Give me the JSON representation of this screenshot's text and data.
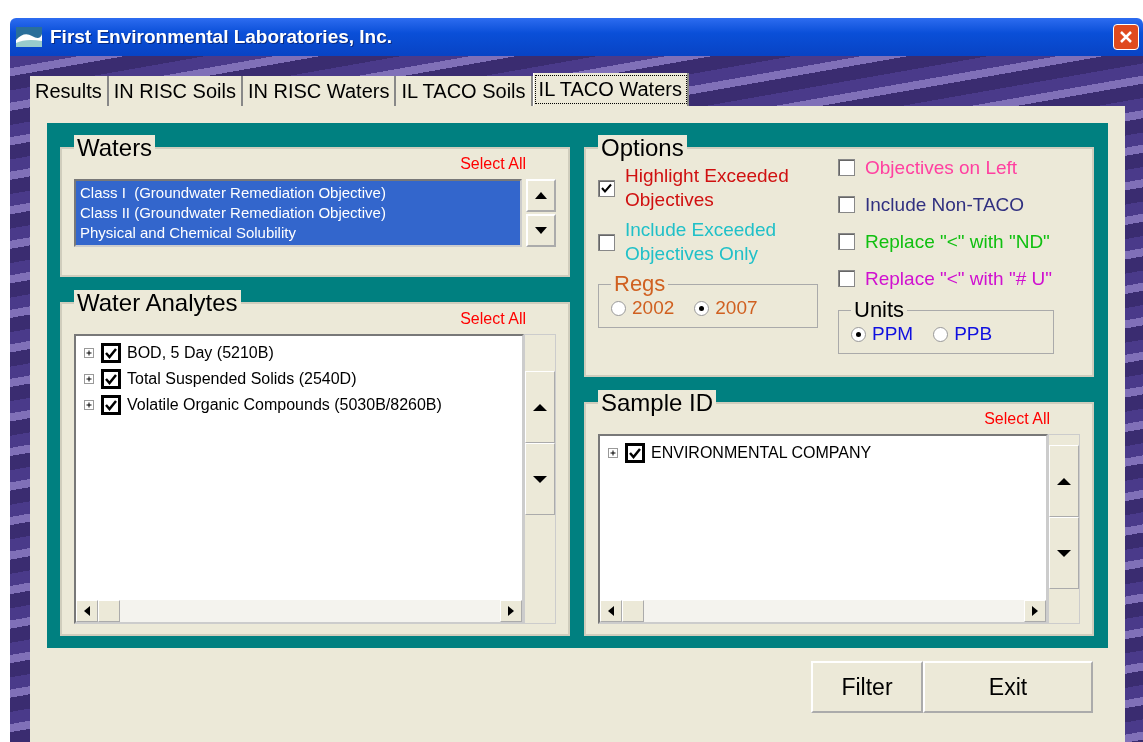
{
  "window": {
    "title": "First Environmental Laboratories, Inc."
  },
  "tabs": [
    {
      "label": "Results",
      "selected": false
    },
    {
      "label": "IN RISC Soils",
      "selected": false
    },
    {
      "label": "IN RISC Waters",
      "selected": false
    },
    {
      "label": "IL TACO Soils",
      "selected": false
    },
    {
      "label": "IL TACO Waters",
      "selected": true
    }
  ],
  "waters": {
    "title": "Waters",
    "select_all": "Select All",
    "items": [
      {
        "label": "Class I  (Groundwater Remediation Objective)",
        "selected": true
      },
      {
        "label": "Class II (Groundwater Remediation Objective)",
        "selected": true
      },
      {
        "label": "Physical and Chemical Solubility",
        "selected": true
      }
    ]
  },
  "water_analytes": {
    "title": "Water Analytes",
    "select_all": "Select All",
    "items": [
      {
        "label": "BOD, 5 Day (5210B)",
        "checked": true,
        "expanded": false
      },
      {
        "label": "Total Suspended Solids (2540D)",
        "checked": true,
        "expanded": false
      },
      {
        "label": "Volatile Organic Compounds (5030B/8260B)",
        "checked": true,
        "expanded": false
      }
    ]
  },
  "options": {
    "title": "Options",
    "left": [
      {
        "label": "Highlight Exceeded Objectives",
        "checked": true,
        "color": "#d01010"
      },
      {
        "label": "Include Exceeded Objectives Only",
        "checked": false,
        "color": "#20c0c8"
      }
    ],
    "right": [
      {
        "label": "Objectives on Left",
        "checked": false,
        "color": "#ff40a0"
      },
      {
        "label": "Include Non-TACO",
        "checked": false,
        "color": "#303080"
      },
      {
        "label": "Replace \"<\" with \"ND\"",
        "checked": false,
        "color": "#10c010"
      },
      {
        "label": "Replace \"<\" with \"# U\"",
        "checked": false,
        "color": "#d010d0"
      }
    ],
    "regs": {
      "title": "Regs",
      "choices": [
        {
          "label": "2002",
          "selected": false
        },
        {
          "label": "2007",
          "selected": true
        }
      ]
    },
    "units": {
      "title": "Units",
      "choices": [
        {
          "label": "PPM",
          "selected": true
        },
        {
          "label": "PPB",
          "selected": false
        }
      ]
    }
  },
  "sample_id": {
    "title": "Sample ID",
    "select_all": "Select All",
    "items": [
      {
        "label": "ENVIRONMENTAL COMPANY",
        "checked": true,
        "expanded": false
      }
    ]
  },
  "buttons": [
    "Filter",
    "Exit"
  ]
}
